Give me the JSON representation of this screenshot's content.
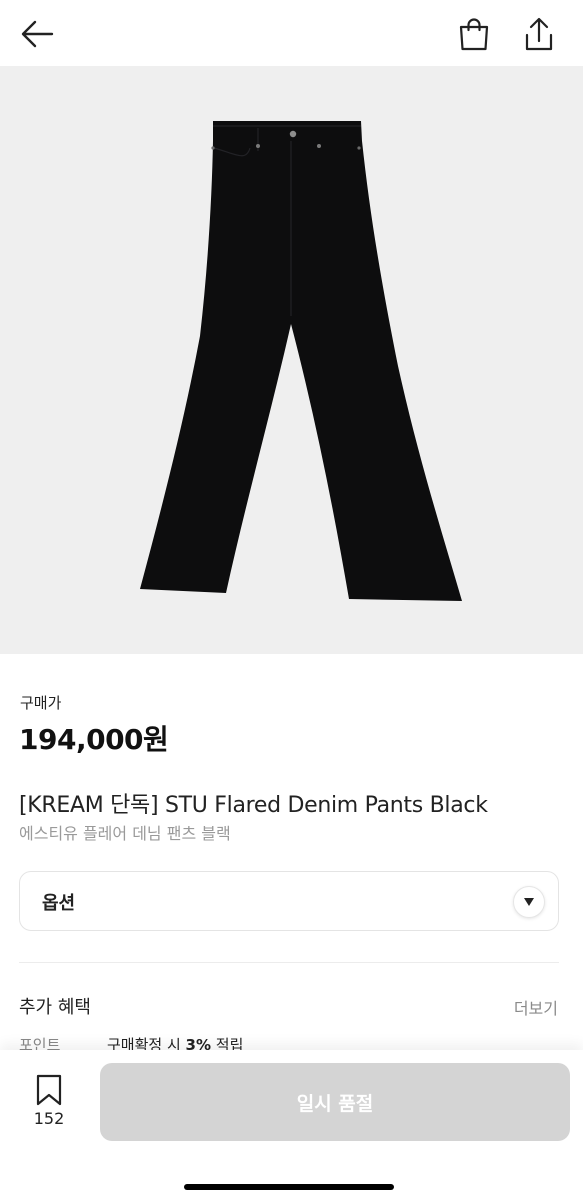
{
  "header": {
    "back_icon": "arrow-left-icon",
    "bag_icon": "shopping-bag-icon",
    "share_icon": "share-upload-icon"
  },
  "product_image": {
    "icon": "black-flared-pants",
    "background_color": "#efefef"
  },
  "pricing": {
    "label": "구매가",
    "price": "194,000원"
  },
  "product": {
    "title": "[KREAM 단독] STU Flared Denim Pants Black",
    "subtitle": "에스티유 플레어 데님 팬츠 블랙"
  },
  "option": {
    "label": "옵션",
    "icon": "dropdown-arrow-icon"
  },
  "benefits": {
    "title": "추가 혜택",
    "more_label": "더보기",
    "point_label": "포인트",
    "point_desc_prefix": "구매확정 시 ",
    "point_rate": "3%",
    "point_desc_suffix": " 적립"
  },
  "bottom_bar": {
    "bookmark_icon": "bookmark-icon",
    "bookmark_count": "152",
    "soldout_label": "일시 품절",
    "soldout_color": "#d4d4d4"
  }
}
